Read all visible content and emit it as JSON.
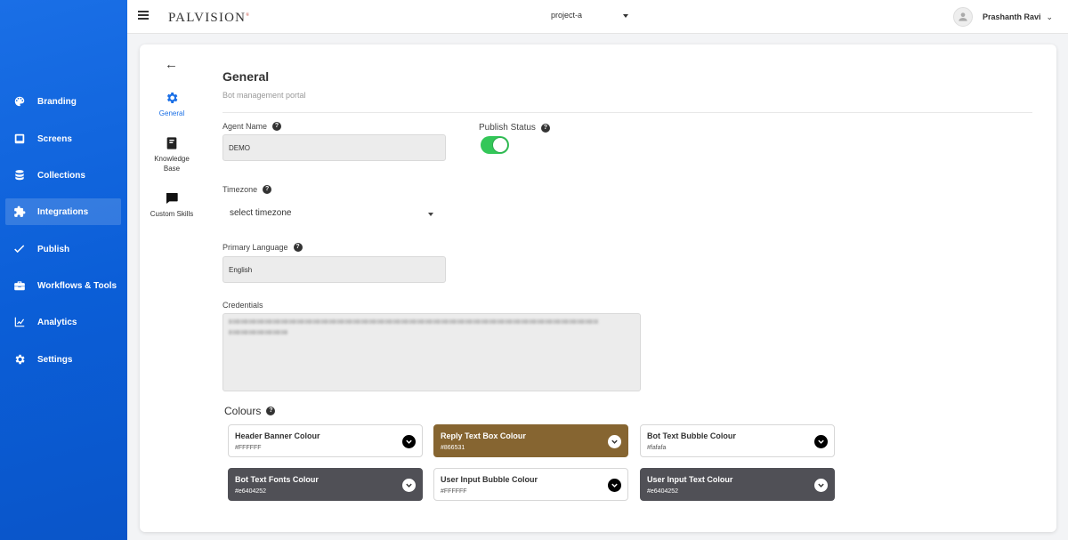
{
  "sidebar": {
    "items": [
      {
        "label": "Branding",
        "icon": "palette-icon"
      },
      {
        "label": "Screens",
        "icon": "screen-icon"
      },
      {
        "label": "Collections",
        "icon": "database-icon"
      },
      {
        "label": "Integrations",
        "icon": "puzzle-icon",
        "active": true
      },
      {
        "label": "Publish",
        "icon": "check-icon"
      },
      {
        "label": "Workflows & Tools",
        "icon": "toolbox-icon"
      },
      {
        "label": "Analytics",
        "icon": "chart-icon"
      },
      {
        "label": "Settings",
        "icon": "gear-icon"
      }
    ]
  },
  "header": {
    "logo": "PALVISION",
    "project": "project-a",
    "user_name": "Prashanth Ravi"
  },
  "subnav": {
    "items": [
      {
        "label": "General",
        "icon": "gear-icon",
        "active": true
      },
      {
        "label": "Knowledge Base",
        "icon": "book-icon"
      },
      {
        "label": "Custom Skills",
        "icon": "chat-icon"
      }
    ]
  },
  "general": {
    "title": "General",
    "subtitle": "Bot management portal",
    "agent_name_label": "Agent Name",
    "agent_name_value": "DEMO",
    "publish_status_label": "Publish Status",
    "publish_status_on": true,
    "timezone_label": "Timezone",
    "timezone_value": "select timezone",
    "primary_language_label": "Primary Language",
    "primary_language_value": "English",
    "credentials_label": "Credentials",
    "colours_label": "Colours"
  },
  "colours": [
    {
      "name": "Header Banner Colour",
      "hex": "#FFFFFF",
      "bg": "#ffffff",
      "dark": false
    },
    {
      "name": "Reply Text Box Colour",
      "hex": "#866531",
      "bg": "#866531",
      "dark": true
    },
    {
      "name": "Bot Text Bubble Colour",
      "hex": "#fafafa",
      "bg": "#ffffff",
      "dark": false
    },
    {
      "name": "Bot Text Fonts Colour",
      "hex": "#e6404252",
      "bg": "#505056",
      "dark": true
    },
    {
      "name": "User Input Bubble Colour",
      "hex": "#FFFFFF",
      "bg": "#ffffff",
      "dark": false
    },
    {
      "name": "User Input Text Colour",
      "hex": "#e6404252",
      "bg": "#505056",
      "dark": true
    }
  ],
  "theme": {
    "sidebar_blue": "#0b5ed7",
    "accent": "#1a6fe6",
    "toggle_on": "#34c759"
  }
}
